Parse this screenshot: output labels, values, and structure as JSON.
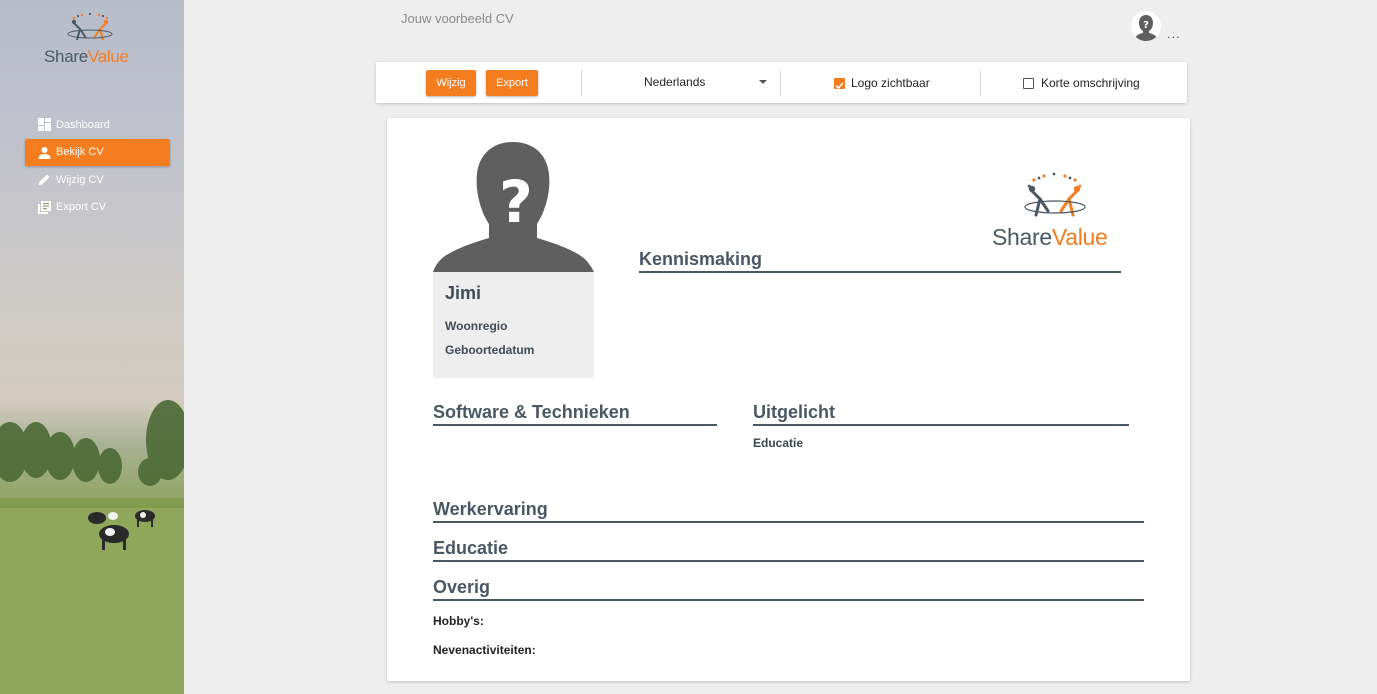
{
  "brand": {
    "name_part1": "Share",
    "name_part2": "Value",
    "accent_color": "#f47d20",
    "dark_color": "#4a5866"
  },
  "sidebar": {
    "items": [
      {
        "label": "Dashboard",
        "icon": "dashboard-icon",
        "active": false
      },
      {
        "label": "Bekijk CV",
        "icon": "person-icon",
        "active": true
      },
      {
        "label": "Wijzig CV",
        "icon": "pencil-icon",
        "active": false
      },
      {
        "label": "Export CV",
        "icon": "library-books-icon",
        "active": false
      }
    ]
  },
  "header": {
    "title": "Jouw voorbeeld CV",
    "more": "..."
  },
  "toolbar": {
    "wijzig_label": "Wijzig",
    "export_label": "Export",
    "language": "Nederlands",
    "logo_visible_label": "Logo zichtbaar",
    "logo_visible_checked": true,
    "short_desc_label": "Korte omschrijving",
    "short_desc_checked": false
  },
  "cv": {
    "name": "Jimi",
    "woonregio_label": "Woonregio",
    "geboortedatum_label": "Geboortedatum",
    "sections": {
      "kennismaking": "Kennismaking",
      "software": "Software & Technieken",
      "uitgelicht": "Uitgelicht",
      "uitgelicht_sub": "Educatie",
      "werkervaring": "Werkervaring",
      "educatie": "Educatie",
      "overig": "Overig"
    },
    "hobbys_label": "Hobby's:",
    "neven_label": "Nevenactiviteiten:"
  }
}
